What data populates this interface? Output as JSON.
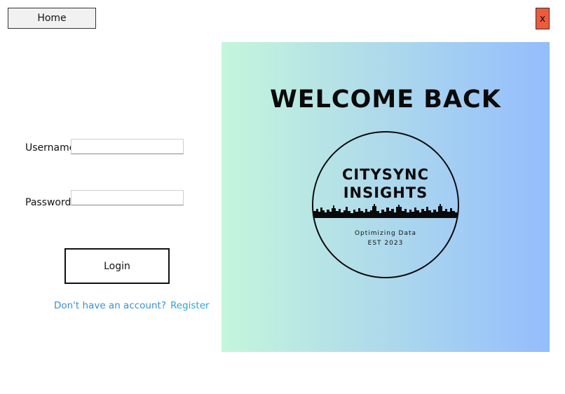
{
  "nav": {
    "home_label": "Home",
    "close_label": "x"
  },
  "form": {
    "username_label": "Username",
    "username_value": "",
    "password_label": "Password",
    "password_value": "",
    "login_label": "Login",
    "register_prompt": "Don't have an account?",
    "register_link": "Register"
  },
  "hero": {
    "title": "WELCOME BACK",
    "logo_line1": "CITYSYNC",
    "logo_line2": "INSIGHTS",
    "tagline": "Optimizing Data",
    "established": "EST 2023"
  },
  "colors": {
    "close_button": "#ee5a3c",
    "gradient_start": "#c4f6dc",
    "gradient_end": "#94bdfd",
    "link": "#2aa3dc"
  }
}
